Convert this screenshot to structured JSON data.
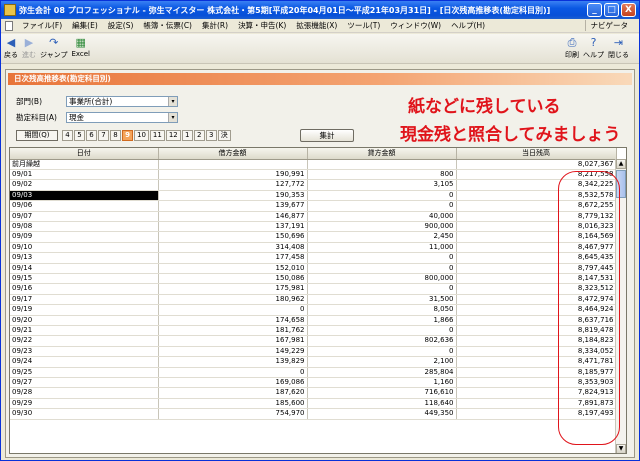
{
  "window": {
    "title": "弥生会計 08 プロフェッショナル - 弥生マイスター 株式会社・第5期[平成20年04月01日～平成21年03月31日] - [日次残高推移表(勘定科目別)]",
    "controls": [
      "_",
      "□",
      "X"
    ]
  },
  "menu": {
    "items": [
      "ファイル(F)",
      "編集(E)",
      "設定(S)",
      "帳簿・伝票(C)",
      "集計(R)",
      "決算・申告(K)",
      "拡張機能(X)",
      "ツール(T)",
      "ウィンドウ(W)",
      "ヘルプ(H)"
    ],
    "navi": "ナビゲータ"
  },
  "toolbar": {
    "back": "戻る",
    "forward": "進む",
    "jump": "ジャンプ",
    "excel": "Excel",
    "print": "印刷",
    "help": "ヘルプ",
    "close": "閉じる"
  },
  "panel": {
    "title": "日次残高推移表(勘定科目別)",
    "department_label": "部門(B)",
    "department_value": "事業所(合計)",
    "account_label": "勘定科目(A)",
    "account_value": "現金",
    "period_label": "期間(Q)",
    "periods": [
      "4",
      "5",
      "6",
      "7",
      "8",
      "9",
      "10",
      "11",
      "12",
      "1",
      "2",
      "3",
      "決"
    ],
    "active_period": "9",
    "calc_button": "集計"
  },
  "annotation": {
    "line1": "紙などに残している",
    "line2": "現金残と照合してみましょう"
  },
  "table": {
    "headers": [
      "日付",
      "借方金額",
      "貸方金額",
      "当日残高"
    ],
    "rows": [
      {
        "date": "前月繰越",
        "debit": "",
        "credit": "",
        "balance": "8,027,367"
      },
      {
        "date": "09/01",
        "debit": "190,991",
        "credit": "800",
        "balance": "8,217,558"
      },
      {
        "date": "09/02",
        "debit": "127,772",
        "credit": "3,105",
        "balance": "8,342,225"
      },
      {
        "date": "09/03",
        "debit": "190,353",
        "credit": "0",
        "balance": "8,532,578"
      },
      {
        "date": "09/06",
        "debit": "139,677",
        "credit": "0",
        "balance": "8,672,255"
      },
      {
        "date": "09/07",
        "debit": "146,877",
        "credit": "40,000",
        "balance": "8,779,132"
      },
      {
        "date": "09/08",
        "debit": "137,191",
        "credit": "900,000",
        "balance": "8,016,323"
      },
      {
        "date": "09/09",
        "debit": "150,696",
        "credit": "2,450",
        "balance": "8,164,569"
      },
      {
        "date": "09/10",
        "debit": "314,408",
        "credit": "11,000",
        "balance": "8,467,977"
      },
      {
        "date": "09/13",
        "debit": "177,458",
        "credit": "0",
        "balance": "8,645,435"
      },
      {
        "date": "09/14",
        "debit": "152,010",
        "credit": "0",
        "balance": "8,797,445"
      },
      {
        "date": "09/15",
        "debit": "150,086",
        "credit": "800,000",
        "balance": "8,147,531"
      },
      {
        "date": "09/16",
        "debit": "175,981",
        "credit": "0",
        "balance": "8,323,512"
      },
      {
        "date": "09/17",
        "debit": "180,962",
        "credit": "31,500",
        "balance": "8,472,974"
      },
      {
        "date": "09/19",
        "debit": "0",
        "credit": "8,050",
        "balance": "8,464,924"
      },
      {
        "date": "09/20",
        "debit": "174,658",
        "credit": "1,866",
        "balance": "8,637,716"
      },
      {
        "date": "09/21",
        "debit": "181,762",
        "credit": "0",
        "balance": "8,819,478"
      },
      {
        "date": "09/22",
        "debit": "167,981",
        "credit": "802,636",
        "balance": "8,184,823"
      },
      {
        "date": "09/23",
        "debit": "149,229",
        "credit": "0",
        "balance": "8,334,052"
      },
      {
        "date": "09/24",
        "debit": "139,829",
        "credit": "2,100",
        "balance": "8,471,781"
      },
      {
        "date": "09/25",
        "debit": "0",
        "credit": "285,804",
        "balance": "8,185,977"
      },
      {
        "date": "09/27",
        "debit": "169,086",
        "credit": "1,160",
        "balance": "8,353,903"
      },
      {
        "date": "09/28",
        "debit": "187,620",
        "credit": "716,610",
        "balance": "7,824,913"
      },
      {
        "date": "09/29",
        "debit": "185,600",
        "credit": "118,640",
        "balance": "7,891,873"
      },
      {
        "date": "09/30",
        "debit": "754,970",
        "credit": "449,350",
        "balance": "8,197,493"
      }
    ],
    "selected_row": 3
  }
}
